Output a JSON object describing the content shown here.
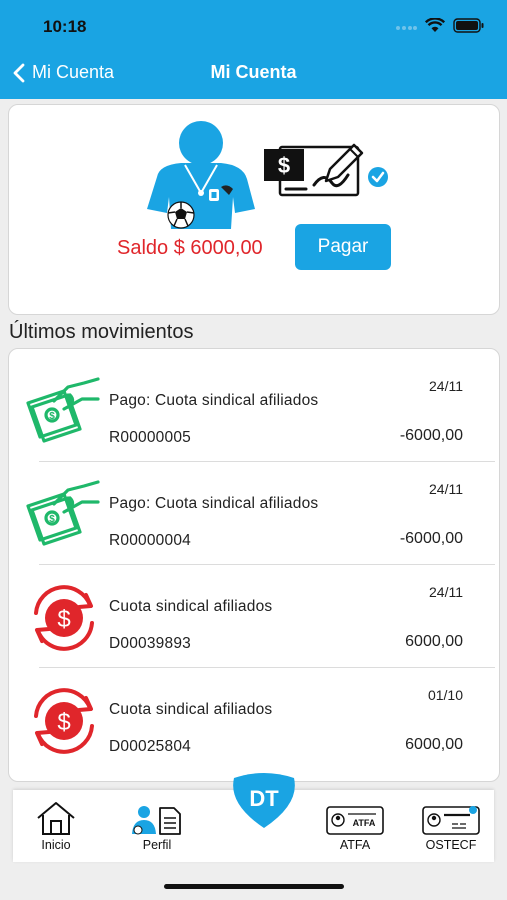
{
  "status_bar": {
    "time": "10:18"
  },
  "nav": {
    "back_label": "Mi Cuenta",
    "title": "Mi Cuenta"
  },
  "balance": {
    "label": "Saldo $ 6000,00",
    "pay_button": "Pagar"
  },
  "section_title": "Últimos movimientos",
  "movements": [
    {
      "icon": "cash-payment-icon",
      "description": "Pago: Cuota  sindical afiliados",
      "code": "R00000005",
      "date": "24/11",
      "amount": "-6000,00"
    },
    {
      "icon": "cash-payment-icon",
      "description": "Pago: Cuota  sindical afiliados",
      "code": "R00000004",
      "date": "24/11",
      "amount": "-6000,00"
    },
    {
      "icon": "dollar-cycle-icon",
      "description": "Cuota  sindical afiliados",
      "code": "D00039893",
      "date": "24/11",
      "amount": "6000,00"
    },
    {
      "icon": "dollar-cycle-icon",
      "description": "Cuota  sindical afiliados",
      "code": "D00025804",
      "date": "01/10",
      "amount": "6000,00"
    }
  ],
  "tabbar": {
    "items": [
      {
        "label": "Inicio",
        "icon": "home-icon"
      },
      {
        "label": "Perfil",
        "icon": "profile-icon"
      },
      {
        "label": "ATFA",
        "icon": "atfa-card-icon"
      },
      {
        "label": "OSTECF",
        "icon": "ostecf-card-icon"
      }
    ],
    "center_logo": "DT"
  },
  "colors": {
    "accent": "#1aa4e3",
    "balance_red": "#e0262b",
    "payment_green": "#1fb86a",
    "charge_red": "#e0262b"
  }
}
